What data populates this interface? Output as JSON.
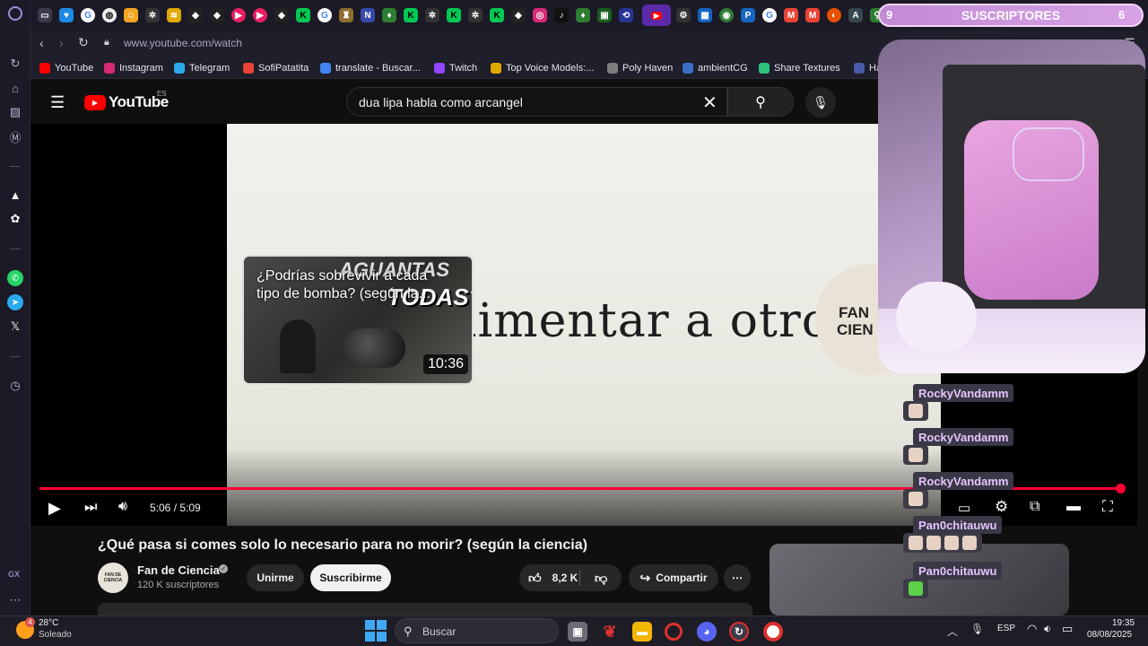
{
  "browser": {
    "url": "www.youtube.com/watch",
    "bookmarks": [
      {
        "label": "YouTube",
        "icon": "youtube-icon",
        "color": "#ff0000"
      },
      {
        "label": "Instagram",
        "icon": "instagram-icon",
        "color": "#d62976"
      },
      {
        "label": "Telegram",
        "icon": "telegram-icon",
        "color": "#2aabee"
      },
      {
        "label": "SofiPatatita",
        "icon": "gmail-icon",
        "color": "#ea4335"
      },
      {
        "label": "translate - Buscar...",
        "icon": "google-icon",
        "color": "#4285f4"
      },
      {
        "label": "Twitch",
        "icon": "twitch-icon",
        "color": "#9146ff"
      },
      {
        "label": "Top Voice Models:...",
        "icon": "books-icon",
        "color": "#e0a800"
      },
      {
        "label": "Poly Haven",
        "icon": "polyhaven-icon",
        "color": "#7d7d7d"
      },
      {
        "label": "ambientCG",
        "icon": "ambientcg-icon",
        "color": "#3b6ec4"
      },
      {
        "label": "Share Textures",
        "icon": "sharetextures-icon",
        "color": "#2ec27e"
      },
      {
        "label": "Har",
        "icon": "har-icon",
        "color": "#4a5aa8"
      }
    ]
  },
  "youtube": {
    "logo_text": "YouTube",
    "region": "ES",
    "search_query": "dua lipa habla como arcangel"
  },
  "player": {
    "frame_text": "limentar a otros",
    "logo_badge_line1": "FAN",
    "logo_badge_line2": "CIEN",
    "endcard": {
      "title": "¿Podrías sobrevivir a cada tipo de bomba? (según la...",
      "thumb_text1": "AGUANTAS",
      "thumb_text2": "TODAS?",
      "duration": "10:36"
    },
    "time_current": "5:06",
    "time_total": "5:09",
    "progress": 0.99
  },
  "video": {
    "title": "¿Qué pasa si comes solo lo necesario para no morir? (según la ciencia)",
    "channel": "Fan de Ciencia",
    "avatar_text": "FAN DE CIENCIA",
    "subscribers": "120 K suscriptores",
    "join_label": "Unirme",
    "subscribe_label": "Suscribirme",
    "likes": "8,2 K",
    "share_label": "Compartir"
  },
  "overlay": {
    "subs_left": "9",
    "subs_label": "SUSCRIPTORES",
    "subs_right": "6",
    "chat": [
      {
        "user": "RockyVandamm"
      },
      {
        "user": "RockyVandamm"
      },
      {
        "user": "RockyVandamm"
      },
      {
        "user": "Pan0chitauwu"
      },
      {
        "user": "Pan0chitauwu"
      }
    ]
  },
  "taskbar": {
    "weather_temp": "28°C",
    "weather_desc": "Soleado",
    "weather_badge": "4",
    "search_placeholder": "Buscar",
    "lang": "ESP",
    "time": "19:35",
    "date": "08/08/2025"
  },
  "sidebar": {
    "gx_label": "GX"
  }
}
